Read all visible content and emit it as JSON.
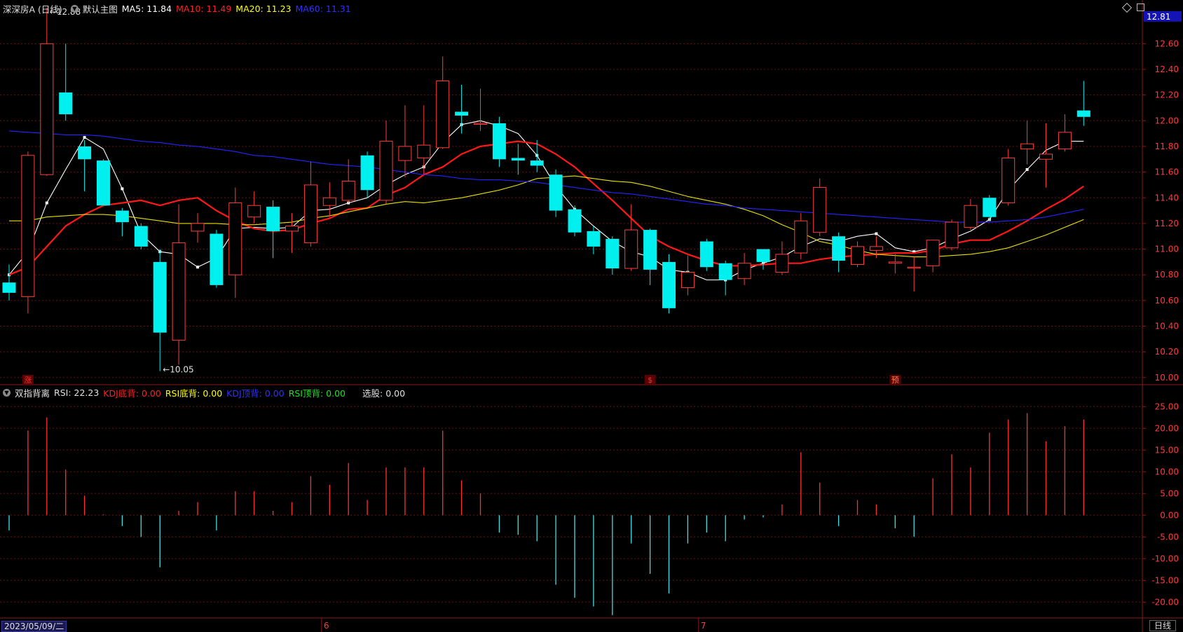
{
  "main_header": {
    "stock": "深深房A (日线)",
    "template": "默认主图",
    "ma5": {
      "label": "MA5: 11.84",
      "color": "#ffffff"
    },
    "ma10": {
      "label": "MA10: 11.49",
      "color": "#ff2020"
    },
    "ma20": {
      "label": "MA20: 11.23",
      "color": "#ffff00"
    },
    "ma60": {
      "label": "MA60: 11.31",
      "color": "#2020ff"
    }
  },
  "sub_header": {
    "indicator": "双指背离",
    "rsi": {
      "label": "RSI: 22.23",
      "color": "#e0e0e0"
    },
    "kdj_bottom": {
      "label": "KDJ底背: 0.00",
      "color": "#ff2020"
    },
    "rsi_bottom": {
      "label": "RSI底背: 0.00",
      "color": "#ffff00"
    },
    "kdj_top": {
      "label": "KDJ顶背: 0.00",
      "color": "#2020ff"
    },
    "rsi_top": {
      "label": "RSI顶背: 0.00",
      "color": "#20e020"
    },
    "pick": {
      "label": "选股: 0.00",
      "color": "#e0e0e0"
    }
  },
  "footer": {
    "date": "2023/05/09/二",
    "period": "日线"
  },
  "chart_data": [
    {
      "type": "candlestick",
      "current_price": "12.81",
      "ylim": [
        9.95,
        12.82
      ],
      "yticks": [
        "10.00",
        "10.20",
        "10.40",
        "10.60",
        "10.80",
        "11.00",
        "11.20",
        "11.40",
        "11.60",
        "11.80",
        "12.00",
        "12.20",
        "12.40",
        "12.60"
      ],
      "month_labels": [
        {
          "index": 17,
          "label": "6"
        },
        {
          "index": 37,
          "label": "7"
        }
      ],
      "annotations": [
        {
          "index": 2,
          "price": 12.88,
          "label": "12.88"
        },
        {
          "index": 8,
          "price": 10.05,
          "label": "10.05"
        }
      ],
      "markers": [
        {
          "index": 1,
          "label": "涨",
          "color": "#ff3030"
        },
        {
          "index": 34,
          "label": "$",
          "color": "#ff3030"
        },
        {
          "index": 47,
          "label": "预",
          "color": "#ff8030"
        }
      ],
      "candles": [
        [
          10.74,
          10.66,
          10.88,
          10.6
        ],
        [
          10.63,
          11.73,
          11.76,
          10.5
        ],
        [
          11.58,
          12.6,
          12.88,
          11.57
        ],
        [
          12.22,
          12.05,
          12.6,
          12.0
        ],
        [
          11.8,
          11.7,
          11.85,
          11.45
        ],
        [
          11.69,
          11.34,
          11.7,
          11.34
        ],
        [
          11.3,
          11.21,
          11.32,
          11.1
        ],
        [
          11.18,
          11.02,
          11.2,
          11.0
        ],
        [
          10.9,
          10.35,
          11.0,
          10.05
        ],
        [
          10.29,
          11.05,
          11.35,
          10.1
        ],
        [
          11.14,
          11.2,
          11.28,
          11.05
        ],
        [
          11.12,
          10.72,
          11.15,
          10.7
        ],
        [
          10.8,
          11.36,
          11.48,
          10.62
        ],
        [
          11.25,
          11.34,
          11.45,
          11.2
        ],
        [
          11.33,
          11.14,
          11.38,
          10.93
        ],
        [
          11.14,
          11.18,
          11.28,
          10.97
        ],
        [
          11.05,
          11.5,
          11.68,
          11.02
        ],
        [
          11.34,
          11.4,
          11.52,
          11.25
        ],
        [
          11.38,
          11.53,
          11.7,
          11.36
        ],
        [
          11.73,
          11.46,
          11.76,
          11.4
        ],
        [
          11.38,
          11.84,
          12.0,
          11.35
        ],
        [
          11.69,
          11.8,
          12.12,
          11.56
        ],
        [
          11.71,
          11.81,
          12.12,
          11.58
        ],
        [
          11.79,
          12.31,
          12.5,
          11.78
        ],
        [
          12.07,
          12.04,
          12.28,
          11.9
        ],
        [
          11.98,
          11.98,
          12.25,
          11.92
        ],
        [
          11.98,
          11.7,
          12.03,
          11.64
        ],
        [
          11.71,
          11.69,
          11.82,
          11.58
        ],
        [
          11.69,
          11.65,
          11.85,
          11.6
        ],
        [
          11.58,
          11.3,
          11.62,
          11.25
        ],
        [
          11.31,
          11.13,
          11.34,
          11.1
        ],
        [
          11.14,
          11.02,
          11.18,
          10.96
        ],
        [
          11.08,
          10.85,
          11.1,
          10.8
        ],
        [
          10.85,
          11.15,
          11.35,
          10.83
        ],
        [
          11.15,
          10.84,
          11.16,
          10.72
        ],
        [
          10.9,
          10.54,
          10.96,
          10.5
        ],
        [
          10.7,
          10.82,
          10.95,
          10.64
        ],
        [
          11.06,
          10.86,
          11.08,
          10.83
        ],
        [
          10.89,
          10.76,
          10.91,
          10.64
        ],
        [
          10.77,
          10.89,
          10.97,
          10.72
        ],
        [
          11.0,
          10.9,
          11.0,
          10.84
        ],
        [
          10.82,
          10.96,
          11.06,
          10.8
        ],
        [
          10.97,
          11.22,
          11.28,
          10.92
        ],
        [
          11.13,
          11.48,
          11.55,
          11.1
        ],
        [
          11.1,
          10.91,
          11.13,
          10.82
        ],
        [
          10.88,
          11.02,
          11.06,
          10.86
        ],
        [
          10.99,
          11.02,
          11.1,
          10.93
        ],
        [
          10.89,
          10.9,
          10.96,
          10.81
        ],
        [
          10.86,
          10.86,
          10.94,
          10.67
        ],
        [
          10.87,
          11.07,
          11.07,
          10.82
        ],
        [
          11.01,
          11.21,
          11.23,
          10.99
        ],
        [
          11.17,
          11.34,
          11.39,
          11.15
        ],
        [
          11.4,
          11.25,
          11.42,
          11.22
        ],
        [
          11.36,
          11.71,
          11.78,
          11.34
        ],
        [
          11.78,
          11.82,
          12.0,
          11.66
        ],
        [
          11.7,
          11.74,
          11.98,
          11.48
        ],
        [
          11.78,
          11.91,
          12.05,
          11.76
        ],
        [
          12.08,
          12.03,
          12.31,
          11.96
        ]
      ],
      "series": [
        {
          "name": "MA5",
          "color": "#ffffff",
          "width": 1.1,
          "markers": true,
          "values": [
            10.8,
            10.98,
            11.36,
            11.62,
            11.87,
            11.78,
            11.47,
            11.12,
            10.98,
            10.96,
            10.86,
            10.93,
            11.16,
            11.17,
            11.16,
            11.17,
            11.3,
            11.31,
            11.36,
            11.4,
            11.5,
            11.58,
            11.64,
            11.83,
            11.97,
            12.0,
            11.96,
            11.9,
            11.73,
            11.49,
            11.31,
            11.18,
            11.06,
            10.98,
            10.94,
            10.84,
            10.82,
            10.76,
            10.76,
            10.84,
            10.89,
            10.94,
            11.02,
            11.08,
            11.06,
            11.1,
            11.12,
            11.01,
            10.98,
            11.01,
            11.08,
            11.14,
            11.23,
            11.46,
            11.62,
            11.77,
            11.84,
            11.84
          ]
        },
        {
          "name": "MA10",
          "color": "#ff1818",
          "width": 2.2,
          "markers": false,
          "values": [
            10.8,
            10.86,
            11.02,
            11.18,
            11.27,
            11.34,
            11.36,
            11.38,
            11.34,
            11.38,
            11.4,
            11.3,
            11.22,
            11.16,
            11.14,
            11.15,
            11.2,
            11.24,
            11.31,
            11.32,
            11.42,
            11.48,
            11.58,
            11.64,
            11.74,
            11.8,
            11.82,
            11.84,
            11.82,
            11.74,
            11.64,
            11.51,
            11.38,
            11.24,
            11.1,
            11.02,
            10.96,
            10.91,
            10.87,
            10.87,
            10.88,
            10.89,
            10.89,
            10.92,
            10.94,
            10.95,
            10.96,
            10.97,
            10.97,
            10.99,
            11.04,
            11.07,
            11.07,
            11.14,
            11.22,
            11.31,
            11.39,
            11.49
          ]
        },
        {
          "name": "MA20",
          "color": "#e8e000",
          "width": 1.1,
          "markers": false,
          "values": [
            11.22,
            11.22,
            11.25,
            11.26,
            11.27,
            11.27,
            11.26,
            11.24,
            11.22,
            11.2,
            11.2,
            11.2,
            11.19,
            11.19,
            11.2,
            11.21,
            11.24,
            11.26,
            11.29,
            11.32,
            11.35,
            11.37,
            11.36,
            11.38,
            11.4,
            11.43,
            11.46,
            11.5,
            11.55,
            11.56,
            11.57,
            11.55,
            11.53,
            11.52,
            11.49,
            11.45,
            11.41,
            11.38,
            11.35,
            11.31,
            11.26,
            11.19,
            11.13,
            11.06,
            11.03,
            10.99,
            10.96,
            10.95,
            10.94,
            10.94,
            10.95,
            10.96,
            10.98,
            11.01,
            11.06,
            11.11,
            11.17,
            11.23
          ]
        },
        {
          "name": "MA60",
          "color": "#2424ff",
          "width": 1.1,
          "markers": false,
          "values": [
            11.92,
            11.91,
            11.9,
            11.89,
            11.89,
            11.88,
            11.86,
            11.84,
            11.83,
            11.81,
            11.8,
            11.78,
            11.76,
            11.73,
            11.72,
            11.7,
            11.68,
            11.66,
            11.65,
            11.64,
            11.62,
            11.6,
            11.58,
            11.57,
            11.55,
            11.54,
            11.54,
            11.53,
            11.52,
            11.5,
            11.48,
            11.46,
            11.44,
            11.43,
            11.41,
            11.39,
            11.37,
            11.35,
            11.34,
            11.32,
            11.31,
            11.3,
            11.29,
            11.28,
            11.27,
            11.26,
            11.25,
            11.24,
            11.23,
            11.22,
            11.21,
            11.21,
            11.21,
            11.22,
            11.23,
            11.25,
            11.28,
            11.31
          ]
        }
      ]
    },
    {
      "type": "bar",
      "ylim": [
        -23.5,
        26.5
      ],
      "yticks": [
        "25.00",
        "20.00",
        "15.00",
        "10.00",
        "5.00",
        "0.00",
        "-5.00",
        "-10.00",
        "-15.00",
        "-20.00"
      ],
      "up_color": "#ff3030",
      "down_color": "#40e0e0",
      "values": [
        -3.5,
        19.5,
        22.5,
        10.5,
        4.5,
        0.2,
        -2.5,
        -5.0,
        -12.0,
        1.0,
        3.0,
        -3.5,
        5.5,
        5.5,
        1.0,
        3.0,
        9.0,
        7.0,
        12.0,
        3.5,
        11.0,
        11.0,
        11.0,
        19.5,
        8.0,
        5.0,
        -4.0,
        -4.5,
        -6.0,
        -16.0,
        -19.0,
        -21.0,
        -23.0,
        -6.5,
        -13.5,
        -18.0,
        -6.5,
        -4.0,
        -6.0,
        -1.0,
        -0.5,
        2.5,
        14.5,
        7.5,
        -2.5,
        3.5,
        2.5,
        -3.0,
        -5.0,
        8.5,
        14.0,
        11.0,
        19.0,
        22.0,
        23.5,
        17.0,
        20.5,
        22.0
      ]
    }
  ]
}
